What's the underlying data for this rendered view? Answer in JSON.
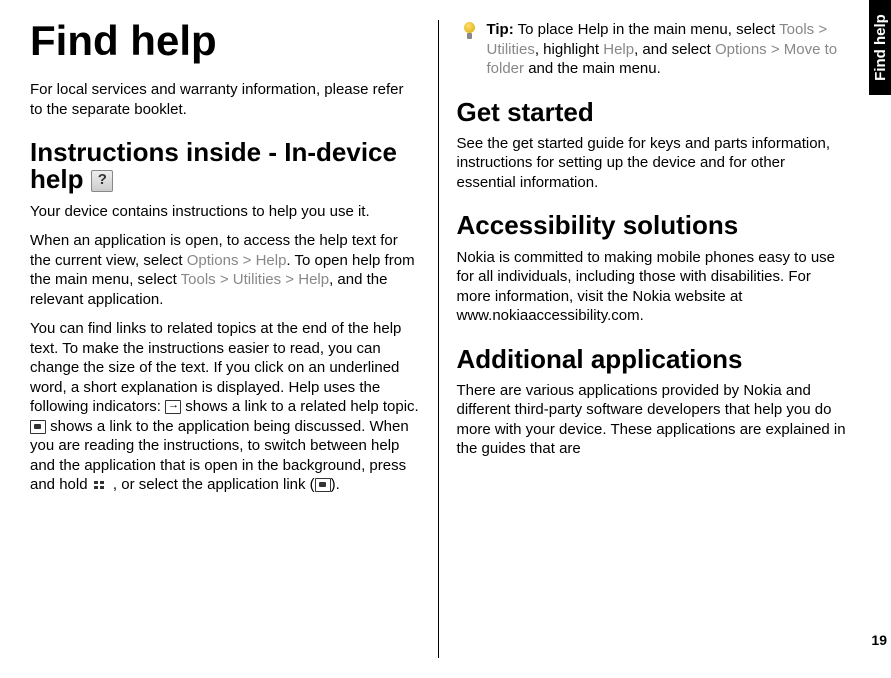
{
  "sideTab": "Find help",
  "pageNumber": "19",
  "left": {
    "h1": "Find help",
    "intro": "For local services and warranty information, please refer to the separate booklet.",
    "h2_instructions": "Instructions inside - In-device help",
    "p_deviceContains": "Your device contains instructions to help you use it.",
    "p_accessHelp_1": "When an application is open, to access the help text for the current view, select ",
    "menu_options": "Options",
    "sep_gt": " > ",
    "menu_help": "Help",
    "p_accessHelp_2": ". To open help from the main menu, select ",
    "menu_tools": "Tools",
    "menu_utilities": "Utilities",
    "p_accessHelp_3": ", and the relevant application.",
    "p_findLinks_1": "You can find links to related topics at the end of the help text. To make the instructions easier to read, you can change the size of the text. If you click on an underlined word, a short explanation is displayed. Help uses the following indicators: ",
    "p_findLinks_2": " shows a link to a related help topic. ",
    "p_findLinks_3": " shows a link to the application being discussed. When you are reading the instructions, to switch between help and the application that is open in the background, press and hold ",
    "p_findLinks_4": " , or select the application link (",
    "p_findLinks_5": ")."
  },
  "right": {
    "tip_label": "Tip:",
    "tip_1": " To place Help in the main menu, select ",
    "tip_2": ", highlight ",
    "tip_3": ", and select ",
    "menu_move": "Move to folder",
    "tip_4": " and the main menu.",
    "h2_getStarted": "Get started",
    "p_getStarted": "See the get started guide for keys and parts information, instructions for setting up the device and for other essential information.",
    "h2_accessibility": "Accessibility solutions",
    "p_accessibility": "Nokia is committed to making mobile phones easy to use for all individuals, including those with disabilities. For more information, visit the Nokia website at www.nokiaaccessibility.com.",
    "h2_additional": "Additional applications",
    "p_additional": "There are various applications provided by Nokia and different third-party software developers that help you do more with your device. These applications are explained in the guides that are"
  }
}
